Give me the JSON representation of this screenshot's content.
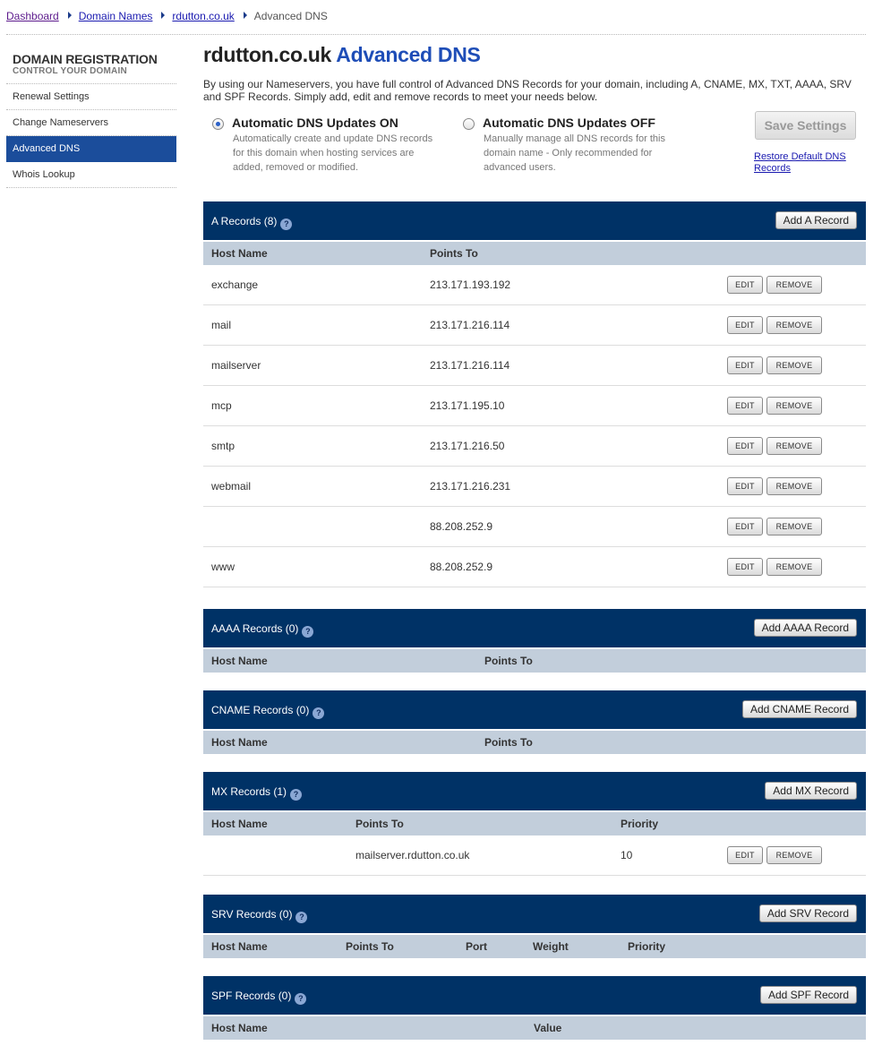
{
  "breadcrumb": {
    "items": [
      "Dashboard",
      "Domain Names",
      "rdutton.co.uk"
    ],
    "current": "Advanced DNS"
  },
  "sidebar": {
    "title": "DOMAIN REGISTRATION",
    "subtitle": "CONTROL YOUR DOMAIN",
    "items": [
      {
        "label": "Renewal Settings"
      },
      {
        "label": "Change Nameservers"
      },
      {
        "label": "Advanced DNS",
        "active": true
      },
      {
        "label": "Whois Lookup"
      }
    ]
  },
  "header": {
    "domain": "rdutton.co.uk",
    "title_accent": "Advanced DNS",
    "intro": "By using our Nameservers, you have full control of Advanced DNS Records for your domain, including A, CNAME, MX, TXT, AAAA, SRV and SPF Records. Simply add, edit and remove records to meet your needs below."
  },
  "options": {
    "on": {
      "title": "Automatic DNS Updates ON",
      "desc": "Automatically create and update DNS records for this domain when hosting services are added, removed or modified.",
      "selected": true
    },
    "off": {
      "title": "Automatic DNS Updates OFF",
      "desc": "Manually manage all DNS records for this domain name - Only recommended for advanced users.",
      "selected": false
    },
    "save_label": "Save Settings",
    "restore_label": "Restore Default DNS Records"
  },
  "row_buttons": {
    "edit": "EDIT",
    "remove": "REMOVE"
  },
  "help_glyph": "?",
  "a_records": {
    "title": "A Records (8)",
    "add_label": "Add A Record",
    "columns": [
      "Host Name",
      "Points To"
    ],
    "rows": [
      {
        "host": "exchange",
        "points_to": "213.171.193.192"
      },
      {
        "host": "mail",
        "points_to": "213.171.216.114"
      },
      {
        "host": "mailserver",
        "points_to": "213.171.216.114"
      },
      {
        "host": "mcp",
        "points_to": "213.171.195.10"
      },
      {
        "host": "smtp",
        "points_to": "213.171.216.50"
      },
      {
        "host": "webmail",
        "points_to": "213.171.216.231"
      },
      {
        "host": "",
        "points_to": "88.208.252.9"
      },
      {
        "host": "www",
        "points_to": "88.208.252.9"
      }
    ]
  },
  "aaaa_records": {
    "title": "AAAA Records (0)",
    "add_label": "Add AAAA Record",
    "columns": [
      "Host Name",
      "Points To"
    ]
  },
  "cname_records": {
    "title": "CNAME Records (0)",
    "add_label": "Add CNAME Record",
    "columns": [
      "Host Name",
      "Points To"
    ]
  },
  "mx_records": {
    "title": "MX Records (1)",
    "add_label": "Add MX Record",
    "columns": [
      "Host Name",
      "Points To",
      "Priority"
    ],
    "rows": [
      {
        "host": "",
        "points_to": "mailserver.rdutton.co.uk",
        "priority": "10"
      }
    ]
  },
  "srv_records": {
    "title": "SRV Records (0)",
    "add_label": "Add SRV Record",
    "columns": [
      "Host Name",
      "Points To",
      "Port",
      "Weight",
      "Priority"
    ]
  },
  "spf_records": {
    "title": "SPF Records (0)",
    "add_label": "Add SPF Record",
    "columns": [
      "Host Name",
      "Value"
    ]
  }
}
